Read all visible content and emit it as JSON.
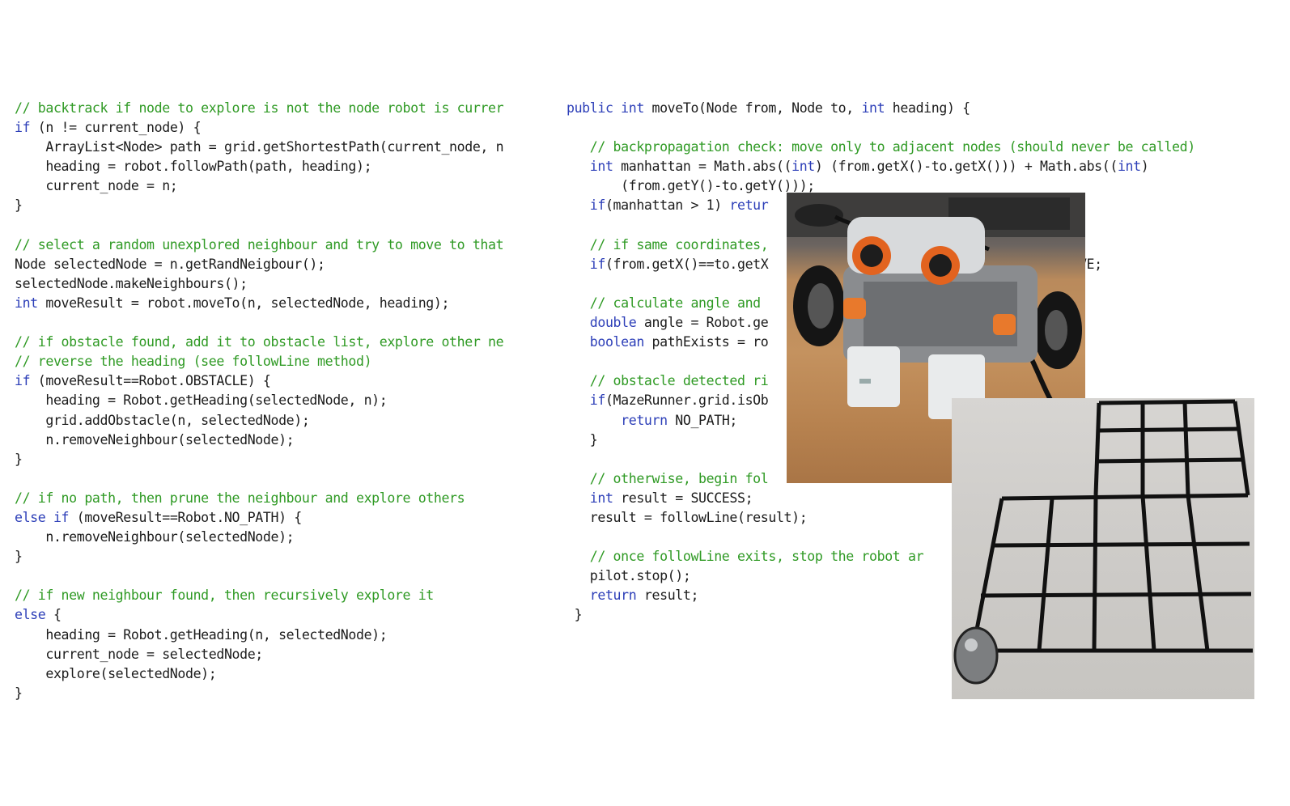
{
  "left_code": [
    [
      [
        "c",
        "// backtrack if node to explore is not the node robot is currer"
      ]
    ],
    [
      [
        "k",
        "if"
      ],
      [
        "t",
        " (n != current_node) {"
      ]
    ],
    [
      [
        "t",
        "    ArrayList<Node> path = grid.getShortestPath(current_node, n"
      ]
    ],
    [
      [
        "t",
        "    heading = robot.followPath(path, heading);"
      ]
    ],
    [
      [
        "t",
        "    current_node = n;"
      ]
    ],
    [
      [
        "t",
        "}"
      ]
    ],
    [
      [
        "t",
        ""
      ]
    ],
    [
      [
        "c",
        "// select a random unexplored neighbour and try to move to that"
      ]
    ],
    [
      [
        "t",
        "Node selectedNode = n.getRandNeigbour();"
      ]
    ],
    [
      [
        "t",
        "selectedNode.makeNeighbours();"
      ]
    ],
    [
      [
        "k",
        "int"
      ],
      [
        "t",
        " moveResult = robot.moveTo(n, selectedNode, heading);"
      ]
    ],
    [
      [
        "t",
        ""
      ]
    ],
    [
      [
        "c",
        "// if obstacle found, add it to obstacle list, explore other ne"
      ]
    ],
    [
      [
        "c",
        "// reverse the heading (see followLine method)"
      ]
    ],
    [
      [
        "k",
        "if"
      ],
      [
        "t",
        " (moveResult==Robot.OBSTACLE) {"
      ]
    ],
    [
      [
        "t",
        "    heading = Robot.getHeading(selectedNode, n);"
      ]
    ],
    [
      [
        "t",
        "    grid.addObstacle(n, selectedNode);"
      ]
    ],
    [
      [
        "t",
        "    n.removeNeighbour(selectedNode);"
      ]
    ],
    [
      [
        "t",
        "}"
      ]
    ],
    [
      [
        "t",
        ""
      ]
    ],
    [
      [
        "c",
        "// if no path, then prune the neighbour and explore others"
      ]
    ],
    [
      [
        "k",
        "else if"
      ],
      [
        "t",
        " (moveResult==Robot.NO_PATH) {"
      ]
    ],
    [
      [
        "t",
        "    n.removeNeighbour(selectedNode);"
      ]
    ],
    [
      [
        "t",
        "}"
      ]
    ],
    [
      [
        "t",
        ""
      ]
    ],
    [
      [
        "c",
        "// if new neighbour found, then recursively explore it"
      ]
    ],
    [
      [
        "k",
        "else"
      ],
      [
        "t",
        " {"
      ]
    ],
    [
      [
        "t",
        "    heading = Robot.getHeading(n, selectedNode);"
      ]
    ],
    [
      [
        "t",
        "    current_node = selectedNode;"
      ]
    ],
    [
      [
        "t",
        "    explore(selectedNode);"
      ]
    ],
    [
      [
        "t",
        "}"
      ]
    ]
  ],
  "right_code": [
    [
      [
        "k",
        "public int"
      ],
      [
        "t",
        " moveTo(Node from, Node to, "
      ],
      [
        "k",
        "int"
      ],
      [
        "t",
        " heading) {"
      ]
    ],
    [
      [
        "t",
        ""
      ]
    ],
    [
      [
        "c",
        "   // backpropagation check: move only to adjacent nodes (should never be called)"
      ]
    ],
    [
      [
        "k",
        "   int"
      ],
      [
        "t",
        " manhattan = Math.abs(("
      ],
      [
        "k",
        "int"
      ],
      [
        "t",
        ") (from.getX()-to.getX())) + Math.abs(("
      ],
      [
        "k",
        "int"
      ],
      [
        "t",
        ")"
      ]
    ],
    [
      [
        "t",
        "       (from.getY()-to.getY()));"
      ]
    ],
    [
      [
        "k",
        "   if"
      ],
      [
        "t",
        "(manhattan > 1) "
      ],
      [
        "k",
        "retur"
      ]
    ],
    [
      [
        "t",
        ""
      ]
    ],
    [
      [
        "c",
        "   // if same coordinates,"
      ]
    ],
    [
      [
        "k",
        "   if"
      ],
      [
        "t",
        "(from.getX()==to.getX                                 n NO_MOVE;"
      ]
    ],
    [
      [
        "t",
        ""
      ]
    ],
    [
      [
        "c",
        "   // calculate angle and                                 ode"
      ]
    ],
    [
      [
        "k",
        "   double"
      ],
      [
        "t",
        " angle = Robot.ge"
      ]
    ],
    [
      [
        "k",
        "   boolean"
      ],
      [
        "t",
        " pathExists = ro"
      ]
    ],
    [
      [
        "t",
        ""
      ]
    ],
    [
      [
        "c",
        "   // obstacle detected ri"
      ]
    ],
    [
      [
        "k",
        "   if"
      ],
      [
        "t",
        "(MazeRunner.grid.isOb"
      ]
    ],
    [
      [
        "k",
        "       return"
      ],
      [
        "t",
        " NO_PATH;"
      ]
    ],
    [
      [
        "t",
        "   }"
      ]
    ],
    [
      [
        "t",
        ""
      ]
    ],
    [
      [
        "c",
        "   // otherwise, begin fol"
      ]
    ],
    [
      [
        "k",
        "   int"
      ],
      [
        "t",
        " result = SUCCESS;"
      ]
    ],
    [
      [
        "t",
        "   result = followLine(result);"
      ]
    ],
    [
      [
        "t",
        ""
      ]
    ],
    [
      [
        "c",
        "   // once followLine exits, stop the robot ar"
      ]
    ],
    [
      [
        "t",
        "   pilot.stop();"
      ]
    ],
    [
      [
        "k",
        "   return"
      ],
      [
        "t",
        " result;"
      ]
    ],
    [
      [
        "t",
        " }"
      ]
    ]
  ],
  "colors": {
    "keyword": "#2d3fb8",
    "comment": "#2f9a24",
    "text": "#1c1c1c"
  },
  "images": {
    "robot_photo": "lego-robot-photo",
    "grid_photo": "floor-grid-photo"
  }
}
